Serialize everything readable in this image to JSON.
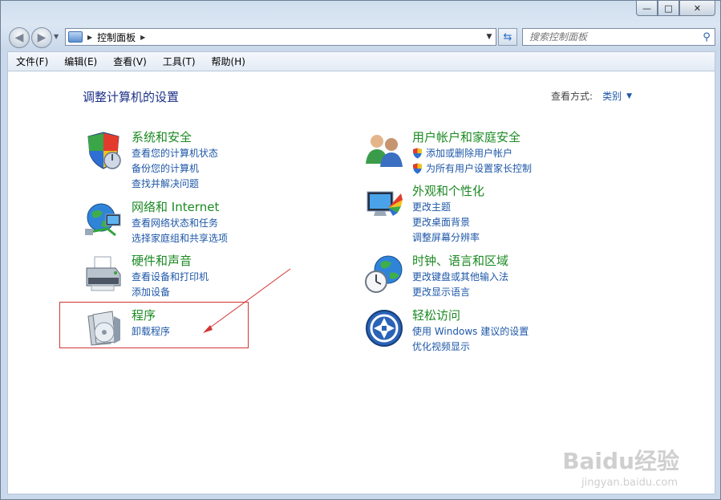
{
  "window": {
    "buttons": {
      "minimize": "▭",
      "maximize": "▢",
      "close": "✕"
    }
  },
  "navigation": {
    "address_path": "控制面板",
    "search_placeholder": "搜索控制面板"
  },
  "menu": {
    "items": [
      "文件(F)",
      "编辑(E)",
      "查看(V)",
      "工具(T)",
      "帮助(H)"
    ]
  },
  "page": {
    "title": "调整计算机的设置",
    "view_by_label": "查看方式:",
    "view_by_value": "类别"
  },
  "categories_left": [
    {
      "title": "系统和安全",
      "icon": "security-shield-icon",
      "links": [
        "查看您的计算机状态",
        "备份您的计算机",
        "查找并解决问题"
      ]
    },
    {
      "title": "网络和 Internet",
      "icon": "network-globe-icon",
      "links": [
        "查看网络状态和任务",
        "选择家庭组和共享选项"
      ]
    },
    {
      "title": "硬件和声音",
      "icon": "printer-icon",
      "links": [
        "查看设备和打印机",
        "添加设备"
      ]
    },
    {
      "title": "程序",
      "icon": "programs-disc-icon",
      "links": [
        "卸载程序"
      ]
    }
  ],
  "categories_right": [
    {
      "title": "用户帐户和家庭安全",
      "icon": "users-icon",
      "links": [
        "添加或删除用户帐户",
        "为所有用户设置家长控制"
      ]
    },
    {
      "title": "外观和个性化",
      "icon": "monitor-colors-icon",
      "links": [
        "更改主题",
        "更改桌面背景",
        "调整屏幕分辨率"
      ]
    },
    {
      "title": "时钟、语言和区域",
      "icon": "clock-globe-icon",
      "links": [
        "更改键盘或其他输入法",
        "更改显示语言"
      ]
    },
    {
      "title": "轻松访问",
      "icon": "ease-of-access-icon",
      "links": [
        "使用 Windows 建议的设置",
        "优化视频显示"
      ]
    }
  ],
  "watermark": {
    "brand": "Baidu经验",
    "url": "jingyan.baidu.com"
  },
  "colors": {
    "category_title": "#1b8a22",
    "link": "#1e57a8",
    "page_title": "#1e3287",
    "annotation": "#d23434"
  }
}
